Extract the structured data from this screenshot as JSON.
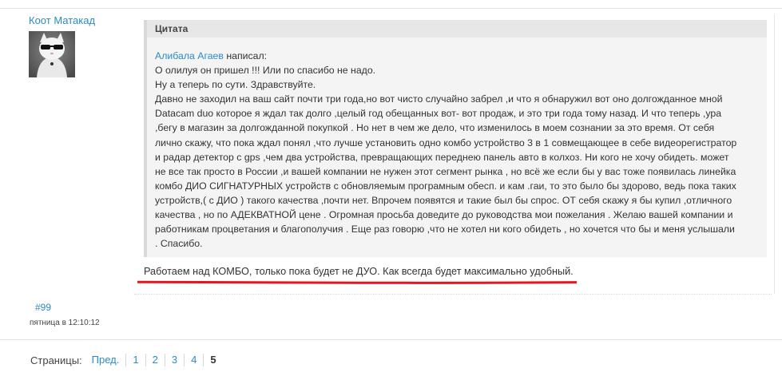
{
  "post": {
    "username": "Коот Матакад",
    "number": "#99",
    "date": "пятница в 12:10:12"
  },
  "quote": {
    "header": "Цитата",
    "author": "Алибала Агаев",
    "wrote": "написал:",
    "lines": [
      "О олилуя он пришел !!! Или по спасибо не надо.",
      "Ну а теперь по сути. Здравствуйте.",
      "Давно не заходил на ваш сайт почти три года,но вот чисто случайно забрел ,и что я обнаружил вот оно долгожданное мной",
      "Datacam duo которое я ждал так долго ,целый год обещанных вот- вот продаж, и это три года тому назад. И что теперь ,ура",
      ",бегу в магазин за долгожданной покупкой . Но нет в чем же дело, что изменилось в моем сознании за это время. От себя",
      "лично скажу, что пока ждал понял ,что лучше установить одно комбо устройство 3 в 1 совмещающее в себе видеорегистратор",
      "и радар детектор с gps ,чем два устройства, превращающих переднею панель авто в колхоз. Ни кого не хочу обидеть. может",
      "не все так просто в России ,и вашей компании не нужен этот сегмент рынка , но всё же если бы у вас тоже появилась линейка",
      "комбо ДИО СИГНАТУРНЫХ устройств с обновляемым програмным обесп. и кам .гаи, то это было бы здорово, ведь пока таких",
      "устройств,( с ДИО ) такого качества ,почти нет. Впрочем появятся и такие был бы спрос. ОТ себя скажу я бы купил ,отличного",
      "качества , но по АДЕКВАТНОЙ цене . Огромная просьба доведите до руководства мои пожелания . Желаю вашей компании и",
      "работникам процветания и благополучия . Еще раз говорю ,что не хотел ни кого обидеть , но хочется что бы и меня услышали",
      ". Спасибо."
    ]
  },
  "reply": "Работаем над КОМБО, только пока будет не ДУО. Как всегда будет максимально удобный.",
  "pagination": {
    "label": "Страницы:",
    "prev": "Пред.",
    "pages": [
      "1",
      "2",
      "3",
      "4"
    ],
    "current": "5"
  },
  "colors": {
    "link": "#2b8bc6",
    "annotation_underline": "#e8141e",
    "quote_bg": "#f4f4f4"
  }
}
